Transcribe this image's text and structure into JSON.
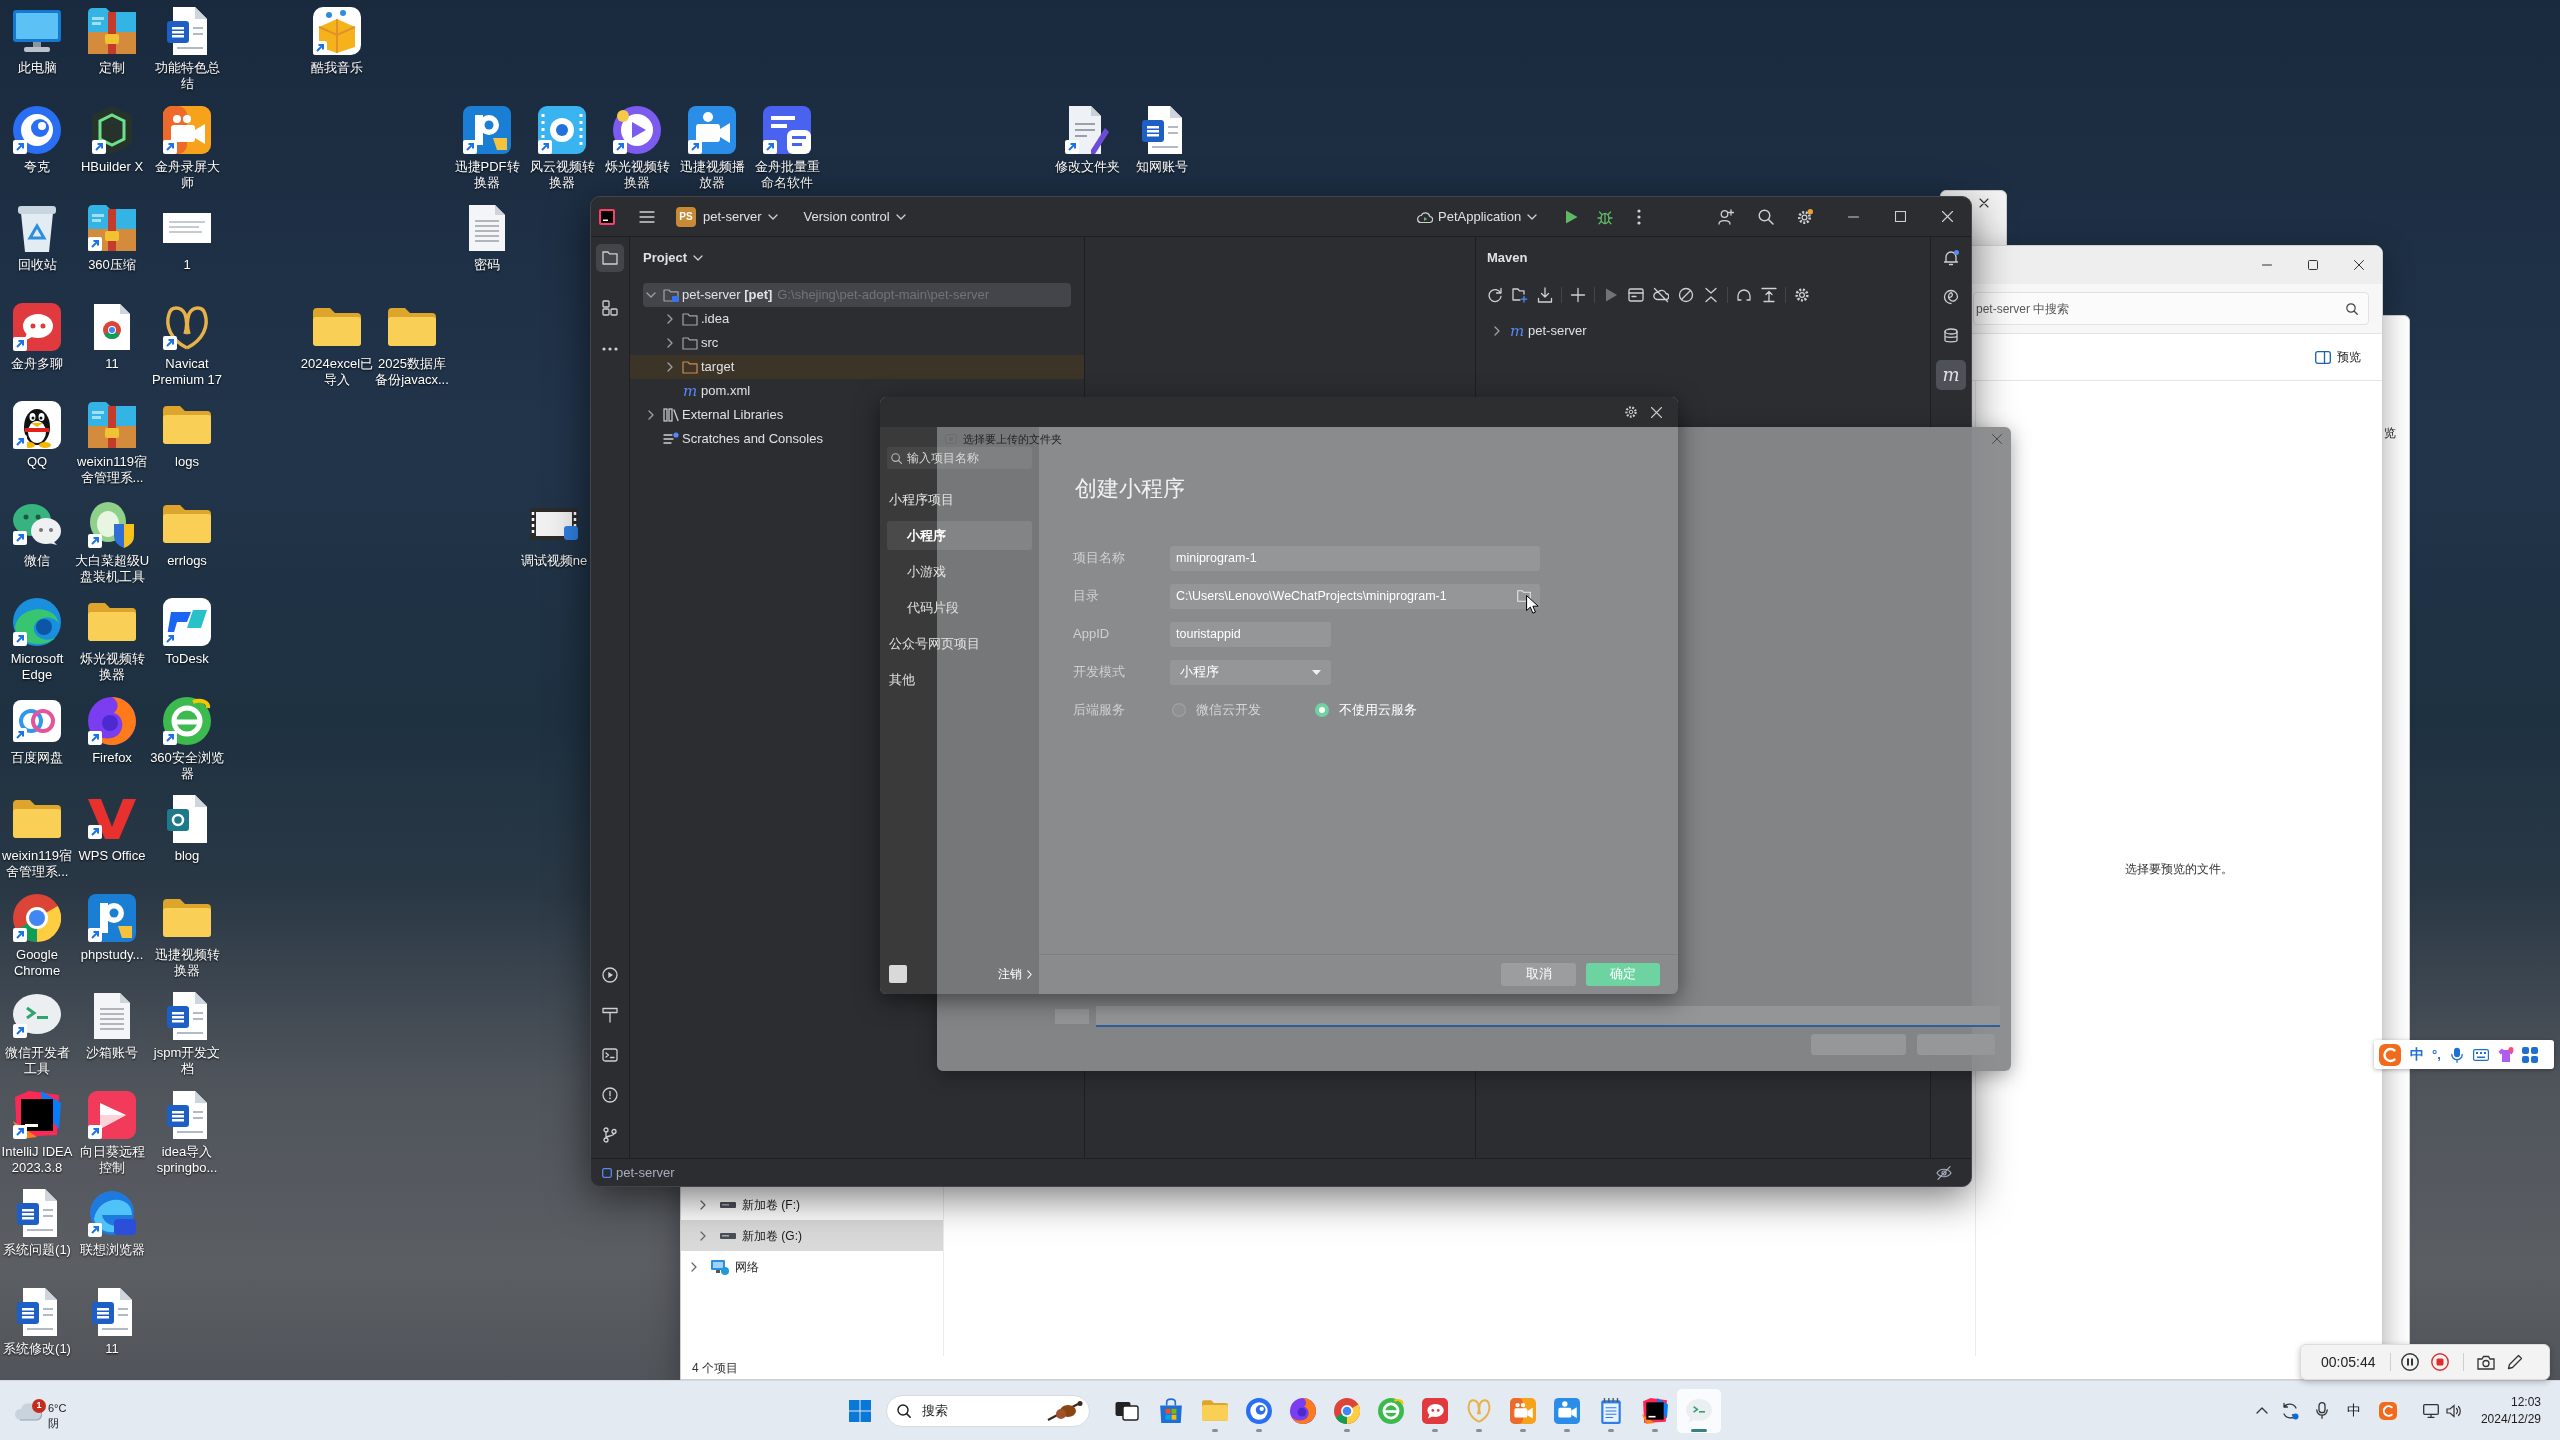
{
  "desktop": {
    "icons": [
      {
        "label": "此电脑",
        "shortcut": false
      },
      {
        "label": "夸克",
        "shortcut": true
      },
      {
        "label": "回收站",
        "shortcut": false
      },
      {
        "label": "金舟多聊",
        "shortcut": true
      },
      {
        "label": "QQ",
        "shortcut": true
      },
      {
        "label": "微信",
        "shortcut": true
      },
      {
        "label": "Microsoft Edge",
        "shortcut": true
      },
      {
        "label": "百度网盘",
        "shortcut": true
      },
      {
        "label": "weixin119宿舍管理系...",
        "shortcut": false
      },
      {
        "label": "Google Chrome",
        "shortcut": true
      },
      {
        "label": "微信开发者工具",
        "shortcut": true
      },
      {
        "label": "IntelliJ IDEA 2023.3.8",
        "shortcut": true
      },
      {
        "label": "系统问题(1)",
        "shortcut": false
      },
      {
        "label": "系统修改(1)",
        "shortcut": false
      },
      {
        "label": "定制",
        "shortcut": false
      },
      {
        "label": "HBuilder X",
        "shortcut": true
      },
      {
        "label": "360压缩",
        "shortcut": true
      },
      {
        "label": "11",
        "shortcut": false
      },
      {
        "label": "weixin119宿舍管理系...",
        "shortcut": false
      },
      {
        "label": "大白菜超级U盘装机工具",
        "shortcut": true
      },
      {
        "label": "烁光视频转换器",
        "shortcut": false
      },
      {
        "label": "Firefox",
        "shortcut": true
      },
      {
        "label": "WPS Office",
        "shortcut": true
      },
      {
        "label": "phpstudy...",
        "shortcut": true
      },
      {
        "label": "沙箱账号",
        "shortcut": false
      },
      {
        "label": "向日葵远程控制",
        "shortcut": true
      },
      {
        "label": "联想浏览器",
        "shortcut": true
      },
      {
        "label": "11",
        "shortcut": false
      },
      {
        "label": "功能特色总结",
        "shortcut": false
      },
      {
        "label": "金舟录屏大师",
        "shortcut": true
      },
      {
        "label": "1",
        "shortcut": false
      },
      {
        "label": "Navicat Premium 17",
        "shortcut": true
      },
      {
        "label": "logs",
        "shortcut": false
      },
      {
        "label": "errlogs",
        "shortcut": false
      },
      {
        "label": "ToDesk",
        "shortcut": true
      },
      {
        "label": "360安全浏览器",
        "shortcut": true
      },
      {
        "label": "blog",
        "shortcut": false
      },
      {
        "label": "迅捷视频转换器",
        "shortcut": false
      },
      {
        "label": "jspm开发文档",
        "shortcut": false
      },
      {
        "label": "idea导入springbo...",
        "shortcut": false
      },
      {
        "label": "酷我音乐",
        "shortcut": true
      },
      {
        "label": "2024excel已导入",
        "shortcut": false
      },
      {
        "label": "2025数据库备份javacx...",
        "shortcut": false
      },
      {
        "label": "迅捷PDF转换器",
        "shortcut": true
      },
      {
        "label": "密码",
        "shortcut": false
      },
      {
        "label": "风云视频转换器",
        "shortcut": true
      },
      {
        "label": "调试视频ne",
        "shortcut": false
      },
      {
        "label": "烁光视频转换器",
        "shortcut": true
      },
      {
        "label": "迅捷视频播放器",
        "shortcut": true
      },
      {
        "label": "金舟批量重命名软件",
        "shortcut": true
      },
      {
        "label": "修改文件夹",
        "shortcut": true
      },
      {
        "label": "知网账号",
        "shortcut": false
      }
    ]
  },
  "ide": {
    "title_bar": {
      "project_badge": "PS",
      "project": "pet-server",
      "vcs": "Version control",
      "run_config": "PetApplication"
    },
    "left_toolbar": [
      {
        "selected": true
      },
      {
        "selected": false
      },
      {
        "selected": false
      }
    ],
    "project_panel": {
      "title": "Project",
      "tree": [
        {
          "name": "pet-server **[pet]**",
          "path": "G:\\shejing\\pet-adopt-main\\pet-server",
          "kind": "module",
          "expanded": true,
          "selected": true,
          "children": [
            {
              "name": ".idea",
              "kind": "folder",
              "expanded": false,
              "selected": false
            },
            {
              "name": "src",
              "kind": "folder",
              "expanded": false,
              "selected": false
            },
            {
              "name": "target",
              "kind": "excluded",
              "expanded": false,
              "selected": false
            },
            {
              "name": "pom.xml",
              "kind": "maven",
              "icon": "m",
              "selected": false
            }
          ]
        },
        {
          "name": "External Libraries",
          "kind": "libraries",
          "expanded": false,
          "selected": false
        },
        {
          "name": "Scratches and Consoles",
          "kind": "scratches",
          "selected": false
        }
      ]
    },
    "maven_panel": {
      "title": "Maven",
      "tree": [
        {
          "name": "pet-server",
          "icon": "m",
          "expanded": false,
          "selected": false
        }
      ]
    },
    "right_toolbar": [
      {
        "selected": false
      },
      {
        "selected": false
      },
      {
        "selected": false
      },
      {
        "icon": "m",
        "selected": true
      }
    ],
    "status_bar": {
      "project": "pet-server"
    }
  },
  "create_dialog": {
    "search": {
      "placeholder": "输入项目名称"
    },
    "sidebar": [
      {
        "label": "小程序项目",
        "selected": false,
        "children": [
          {
            "label": "小程序",
            "selected": true
          },
          {
            "label": "小游戏",
            "selected": false
          },
          {
            "label": "代码片段",
            "selected": false
          }
        ]
      },
      {
        "label": "公众号网页项目",
        "selected": false
      },
      {
        "label": "其他",
        "selected": false
      }
    ],
    "logout": "注销",
    "title": "创建小程序",
    "form": [
      {
        "label": "项目名称",
        "kind": "text",
        "value": "miniprogram-1"
      },
      {
        "label": "目录",
        "kind": "path",
        "value": "C:\\Users\\Lenovo\\WeChatProjects\\miniprogram-1"
      },
      {
        "label": "AppID",
        "kind": "text",
        "value": "touristappid"
      },
      {
        "label": "开发模式",
        "kind": "select",
        "value": "小程序"
      },
      {
        "label": "后端服务",
        "kind": "radio",
        "options": [
          {
            "label": "微信云开发",
            "selected": false,
            "disabled": true
          },
          {
            "label": "不使用云服务",
            "selected": true,
            "disabled": false
          }
        ]
      }
    ],
    "buttons": [
      {
        "label": "取消",
        "kind": "secondary"
      },
      {
        "label": "确定",
        "kind": "primary"
      }
    ]
  },
  "folder_picker": {
    "title": "选择要上传的文件夹"
  },
  "explorer": {
    "search": {
      "placeholder": "pet-server 中搜索"
    },
    "preview_button": "预览",
    "nav": [
      {
        "label": "新加卷 (F:)",
        "kind": "drive",
        "expanded": false,
        "selected": false
      },
      {
        "label": "新加卷 (G:)",
        "kind": "drive",
        "expanded": false,
        "selected": true
      },
      {
        "label": "网络",
        "kind": "network",
        "expanded": false,
        "selected": false
      }
    ],
    "preview_message": "选择要预览的文件。",
    "status": "4 个项目"
  },
  "back_window": {
    "label": "览"
  },
  "ime_toolbar": {
    "mode": "中",
    "punctuation": "°,"
  },
  "recorder": {
    "time": "00:05:44"
  },
  "taskbar": {
    "weather": {
      "badge": "1",
      "temperature": "6°C",
      "condition": "阴"
    },
    "search": {
      "placeholder": "搜索"
    },
    "apps": [
      {
        "running": false,
        "selected": false
      },
      {
        "running": true,
        "selected": false
      },
      {
        "running": true,
        "selected": false
      },
      {
        "running": false,
        "selected": false
      },
      {
        "running": true,
        "selected": false
      },
      {
        "running": false,
        "selected": false
      },
      {
        "running": true,
        "selected": false
      },
      {
        "running": true,
        "selected": false
      },
      {
        "running": true,
        "selected": false
      },
      {
        "running": true,
        "selected": false
      },
      {
        "running": true,
        "selected": false
      },
      {
        "running": true,
        "selected": false
      },
      {
        "running": true,
        "selected": true
      }
    ],
    "tray": {
      "ime": "中",
      "time": "12:03",
      "date": "2024/12/29"
    }
  }
}
